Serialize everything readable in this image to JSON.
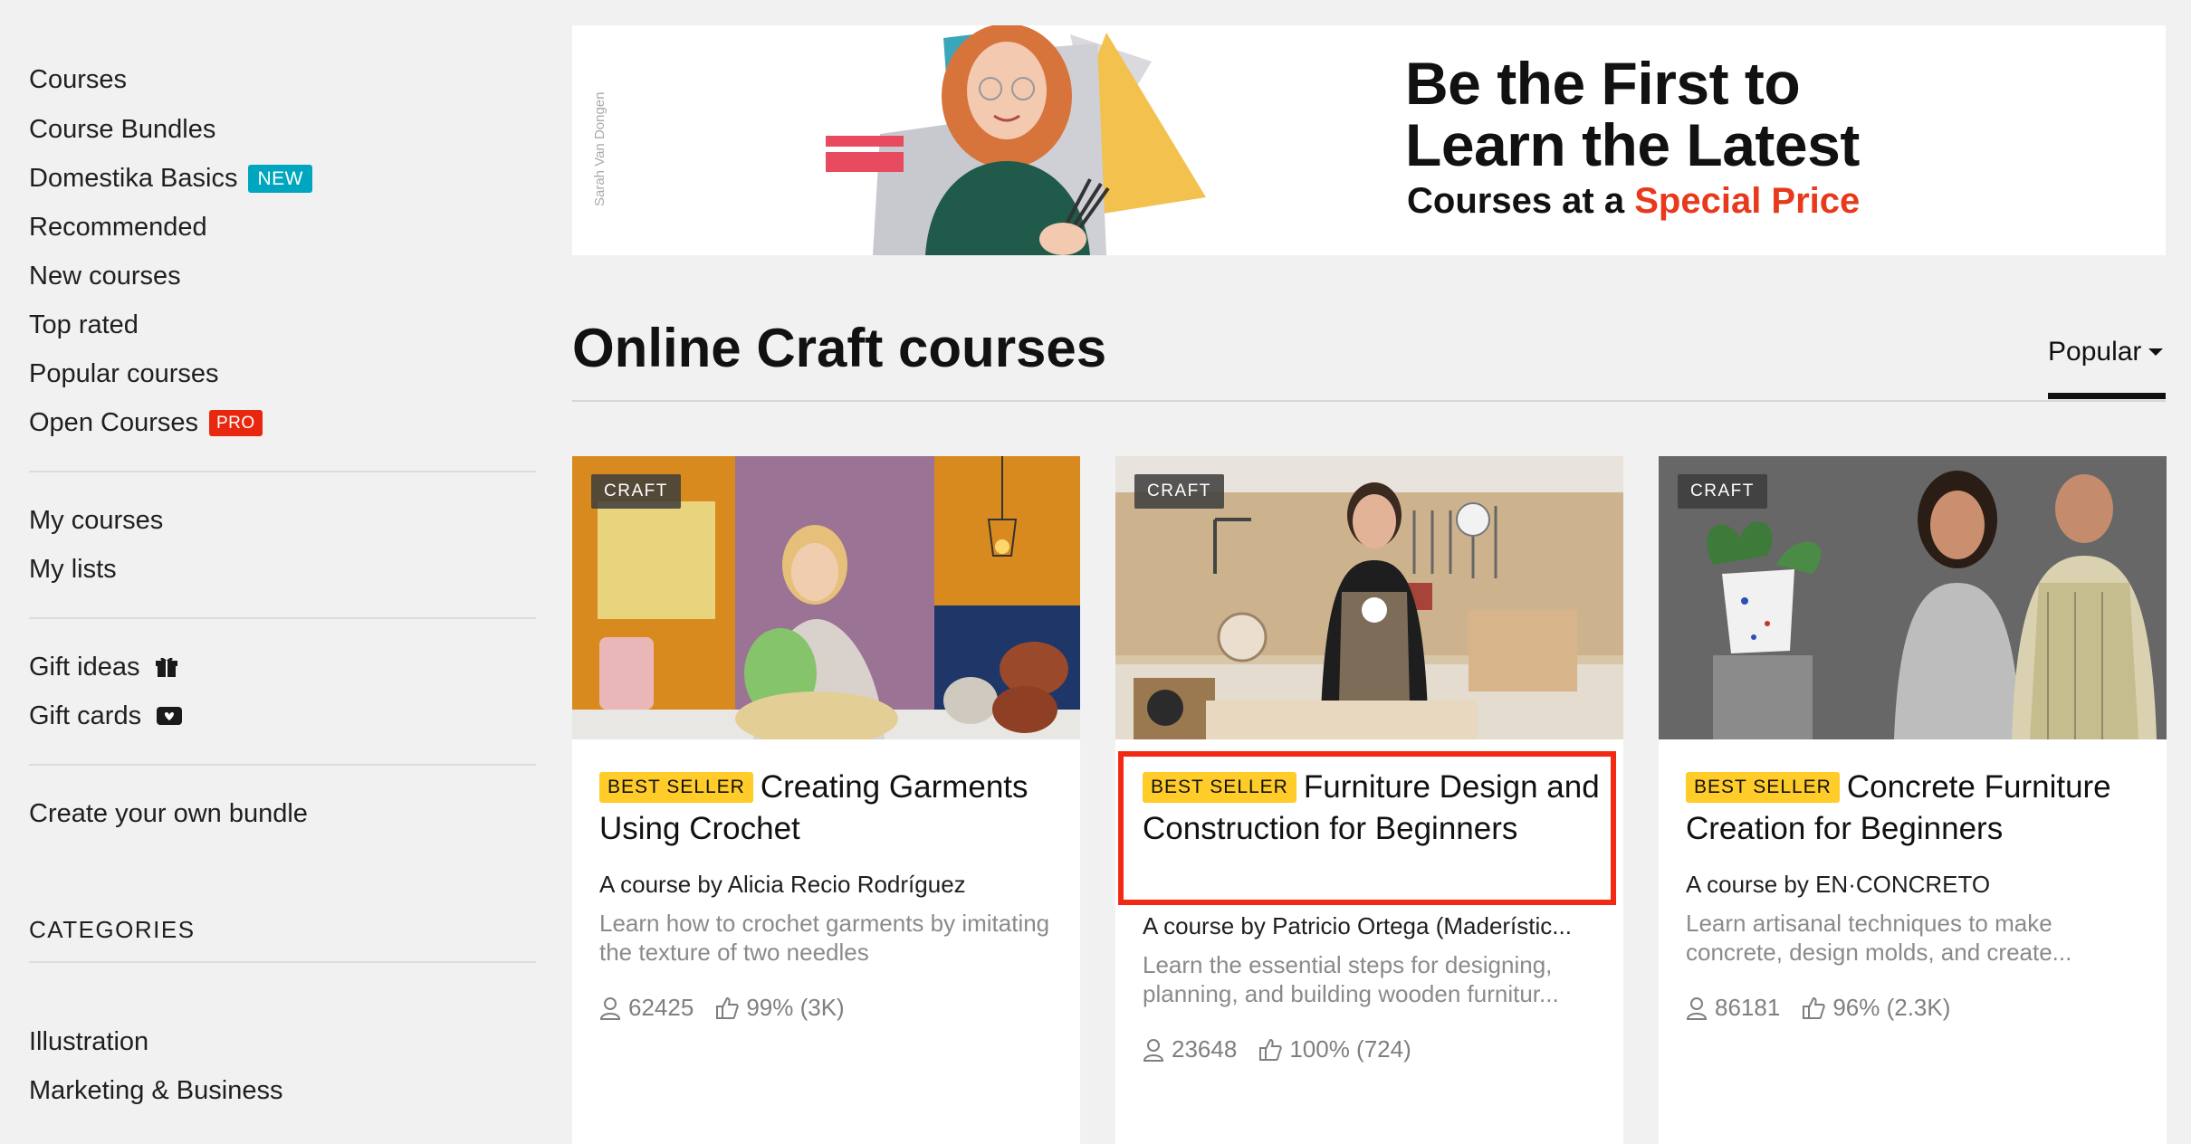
{
  "sidebar": {
    "items": [
      {
        "label": "Courses"
      },
      {
        "label": "Course Bundles"
      },
      {
        "label": "Domestika Basics",
        "badge": "NEW"
      },
      {
        "label": "Recommended"
      },
      {
        "label": "New courses"
      },
      {
        "label": "Top rated"
      },
      {
        "label": "Popular courses"
      },
      {
        "label": "Open Courses",
        "badge": "PRO"
      }
    ],
    "personal": [
      {
        "label": "My courses"
      },
      {
        "label": "My lists"
      }
    ],
    "gifts": [
      {
        "label": "Gift ideas",
        "icon": "gift-icon"
      },
      {
        "label": "Gift cards",
        "icon": "gift-card-icon"
      }
    ],
    "bundle": {
      "label": "Create your own bundle"
    },
    "categories_title": "CATEGORIES",
    "categories": [
      {
        "label": "Illustration"
      },
      {
        "label": "Marketing & Business"
      }
    ]
  },
  "banner": {
    "credit": "Sarah Van Dongen",
    "headline_line1": "Be the First to",
    "headline_line2": "Learn the Latest",
    "sub_prefix": "Courses at a",
    "sub_accent": "Special Price",
    "colors": {
      "accent": "#e8391c",
      "teal": "#3aa6b9",
      "yellow": "#f2c14e",
      "pink": "#e84a5f"
    }
  },
  "heading": {
    "title": "Online Craft courses",
    "sort_label": "Popular"
  },
  "courses": [
    {
      "tag": "CRAFT",
      "badge": "BEST SELLER",
      "title": "Creating Garments Using Crochet",
      "author": "A course by Alicia Recio Rodríguez",
      "description": "Learn how to crochet garments by imitating the texture of two needles",
      "students": "62425",
      "rating": "99% (3K)"
    },
    {
      "tag": "CRAFT",
      "badge": "BEST SELLER",
      "title": "Furniture Design and Construction for Beginners",
      "author": "A course by Patricio Ortega (Maderístic...",
      "description": "Learn the essential steps for designing, planning, and building wooden furnitur...",
      "students": "23648",
      "rating": "100% (724)",
      "highlighted": true
    },
    {
      "tag": "CRAFT",
      "badge": "BEST SELLER",
      "title": "Concrete Furniture Creation for Beginners",
      "author": "A course by EN·CONCRETO",
      "description": "Learn artisanal techniques to make concrete, design molds, and create...",
      "students": "86181",
      "rating": "96% (2.3K)"
    }
  ]
}
